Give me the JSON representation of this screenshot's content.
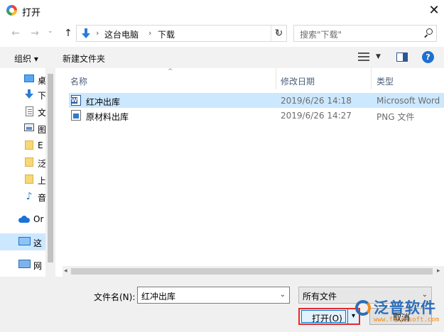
{
  "window": {
    "title": "打开",
    "close_glyph": "✕"
  },
  "navigation": {
    "back_glyph": "←",
    "forward_glyph": "→",
    "recent_glyph": "⌄",
    "up_glyph": "↑",
    "breadcrumb": [
      "这台电脑",
      "下载"
    ],
    "breadcrumb_separator": "›",
    "dropdown_glyph": "⌄",
    "refresh_glyph": "↻"
  },
  "search": {
    "placeholder": "搜索\"下载\""
  },
  "toolbar": {
    "organize_label": "组织 ▾",
    "new_folder_label": "新建文件夹",
    "help_glyph": "?"
  },
  "sidebar": {
    "items": [
      {
        "label": "桌",
        "icon": "desktop-icon"
      },
      {
        "label": "下",
        "icon": "download-icon"
      },
      {
        "label": "文",
        "icon": "document-icon"
      },
      {
        "label": "图",
        "icon": "picture-icon"
      },
      {
        "label": "E",
        "icon": "folder-icon"
      },
      {
        "label": "泛",
        "icon": "folder-icon"
      },
      {
        "label": "上",
        "icon": "folder-icon"
      },
      {
        "label": "音",
        "icon": "music-icon"
      },
      {
        "label": "Or",
        "icon": "onedrive-icon"
      },
      {
        "label": "这",
        "icon": "this-pc-icon",
        "selected": true
      },
      {
        "label": "网",
        "icon": "network-icon"
      }
    ]
  },
  "file_list": {
    "columns": {
      "name": "名称",
      "modified": "修改日期",
      "type": "类型"
    },
    "sort_glyph": "^",
    "rows": [
      {
        "name": "红冲出库",
        "modified": "2019/6/26 14:18",
        "type": "Microsoft Word",
        "icon": "word-doc-icon",
        "selected": true
      },
      {
        "name": "原材料出库",
        "modified": "2019/6/26 14:27",
        "type": "PNG 文件",
        "icon": "png-image-icon",
        "selected": false
      }
    ]
  },
  "scrollbar": {
    "left_glyph": "◂",
    "right_glyph": "▸"
  },
  "footer": {
    "filename_label": "文件名(N):",
    "filename_value": "红冲出库",
    "filename_dropdown_glyph": "⌄",
    "filetype_value": "所有文件",
    "filetype_dropdown_glyph": "⌄",
    "open_label": "打开(O)",
    "open_split_glyph": "▾",
    "cancel_label": "取消"
  },
  "watermark": {
    "name": "泛普软件",
    "url": "www.fanpusoft.com"
  },
  "colors": {
    "accent": "#0078d7",
    "selection": "#cce8ff",
    "highlight_border": "#e52b2b"
  }
}
